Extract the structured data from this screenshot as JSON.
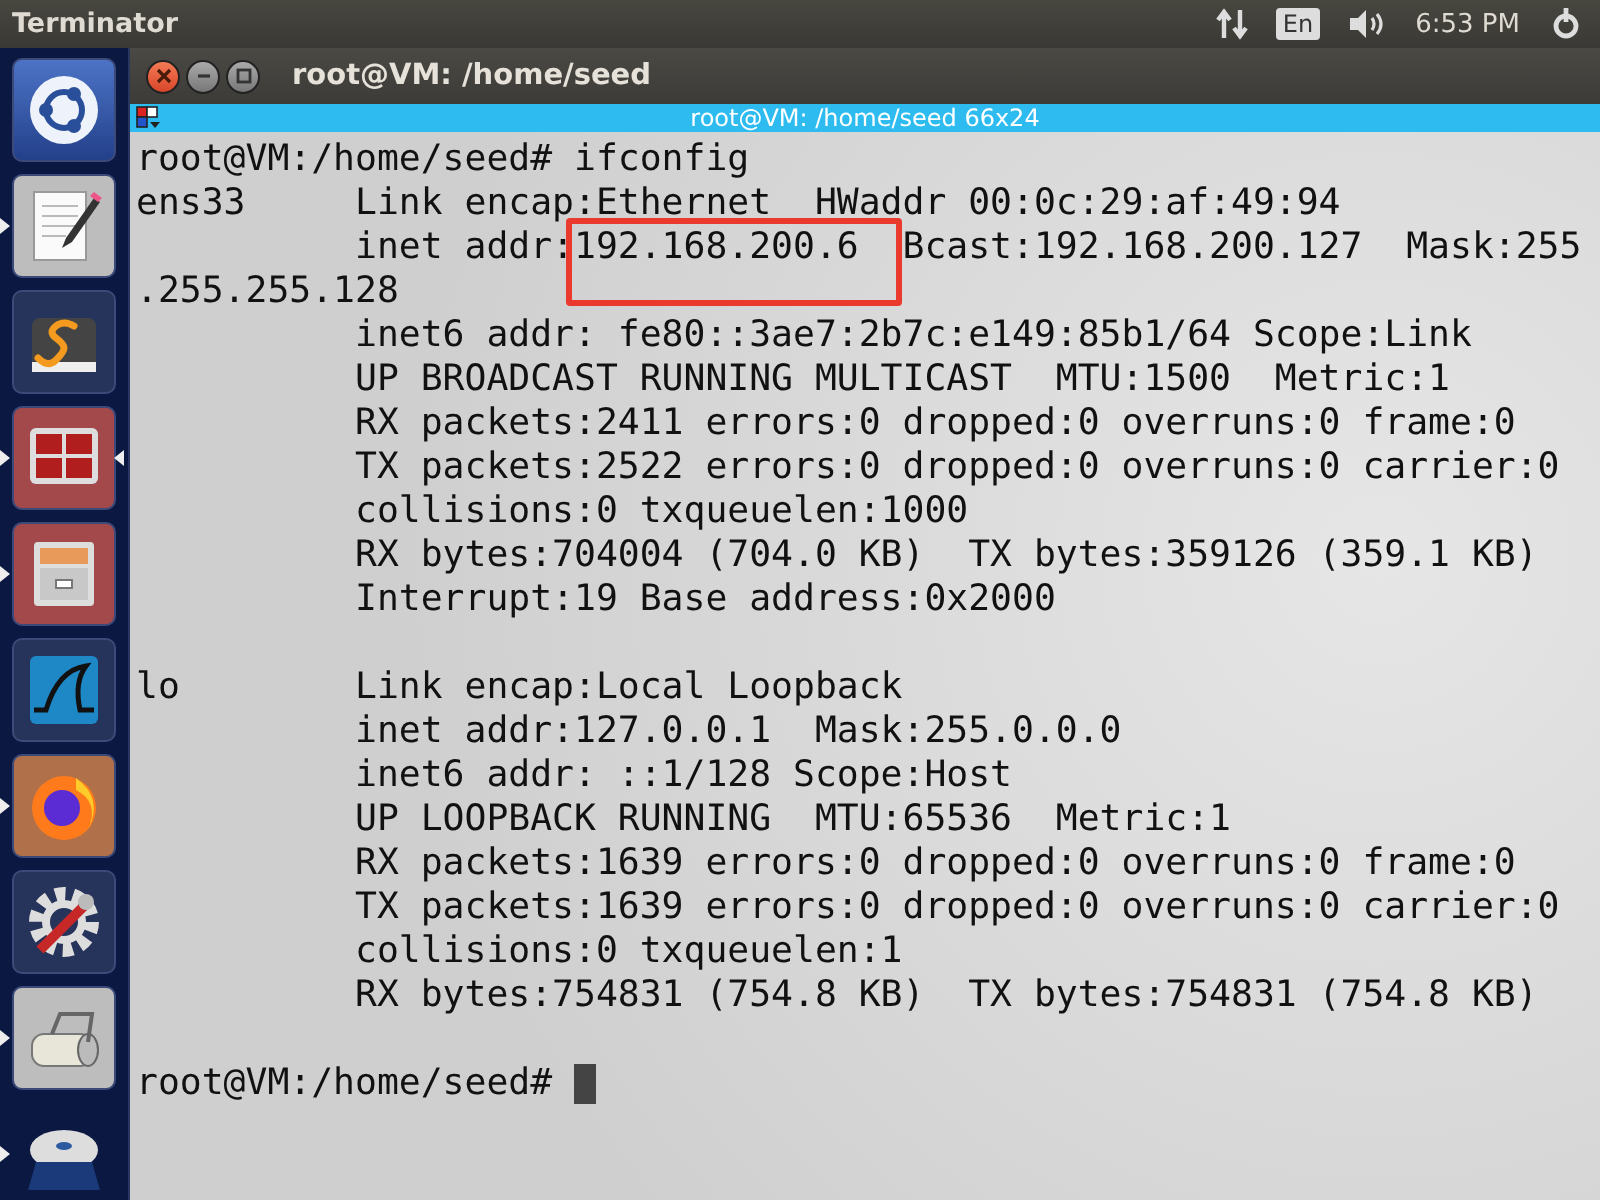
{
  "top_bar": {
    "app_title": "Terminator",
    "keyboard_layout": "En",
    "clock": "6:53 PM"
  },
  "launcher": {
    "items": [
      {
        "kind": "ubuntu",
        "running": false,
        "focused": false
      },
      {
        "kind": "editor",
        "running": true,
        "focused": false
      },
      {
        "kind": "sublime",
        "running": false,
        "focused": false
      },
      {
        "kind": "terminal",
        "running": true,
        "focused": true
      },
      {
        "kind": "files",
        "running": true,
        "focused": false
      },
      {
        "kind": "wireshark",
        "running": false,
        "focused": false
      },
      {
        "kind": "firefox",
        "running": true,
        "focused": false
      },
      {
        "kind": "settings",
        "running": false,
        "focused": false
      },
      {
        "kind": "scanner",
        "running": true,
        "focused": false
      },
      {
        "kind": "dvd",
        "running": true,
        "focused": false
      }
    ]
  },
  "window": {
    "title": "root@VM: /home/seed"
  },
  "terminal": {
    "tab_title": "root@VM: /home/seed 66x24",
    "sections": [
      [
        "root@VM:/home/seed# ifconfig",
        "ens33     Link encap:Ethernet  HWaddr 00:0c:29:af:49:94",
        "          inet addr:192.168.200.6  Bcast:192.168.200.127  Mask:255",
        ".255.255.128",
        "          inet6 addr: fe80::3ae7:2b7c:e149:85b1/64 Scope:Link",
        "          UP BROADCAST RUNNING MULTICAST  MTU:1500  Metric:1",
        "          RX packets:2411 errors:0 dropped:0 overruns:0 frame:0",
        "          TX packets:2522 errors:0 dropped:0 overruns:0 carrier:0",
        "          collisions:0 txqueuelen:1000",
        "          RX bytes:704004 (704.0 KB)  TX bytes:359126 (359.1 KB)",
        "          Interrupt:19 Base address:0x2000"
      ],
      [
        "lo        Link encap:Local Loopback",
        "          inet addr:127.0.0.1  Mask:255.0.0.0",
        "          inet6 addr: ::1/128 Scope:Host",
        "          UP LOOPBACK RUNNING  MTU:65536  Metric:1",
        "          RX packets:1639 errors:0 dropped:0 overruns:0 frame:0",
        "          TX packets:1639 errors:0 dropped:0 overruns:0 carrier:0",
        "          collisions:0 txqueuelen:1",
        "          RX bytes:754831 (754.8 KB)  TX bytes:754831 (754.8 KB)"
      ]
    ],
    "prompt": "root@VM:/home/seed# "
  }
}
